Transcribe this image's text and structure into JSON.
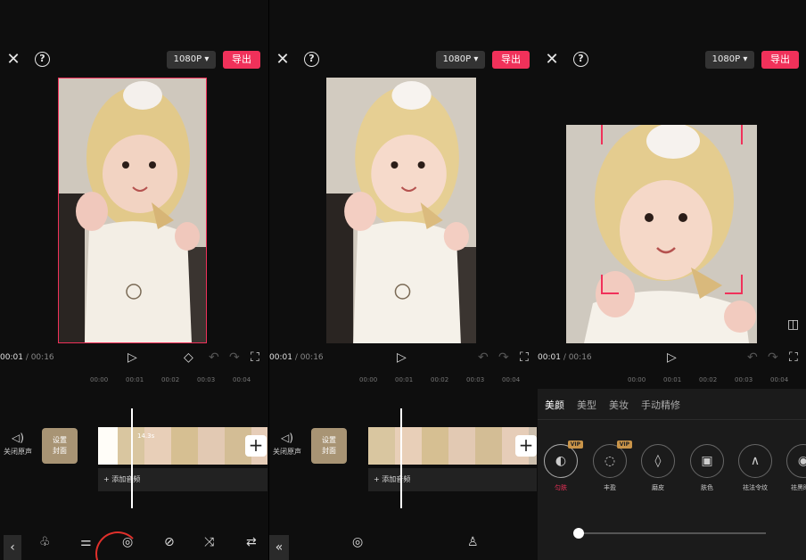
{
  "colors": {
    "accent": "#f0315a",
    "bg": "#0e0e0e"
  },
  "top": {
    "resolution": "1080P ▾",
    "export_label": "导出",
    "close_glyph": "✕",
    "help_glyph": "?"
  },
  "player": {
    "p1": {
      "time_current": "00:01",
      "time_total": "/ 00:16"
    },
    "p2": {
      "time_current": "00:01",
      "time_total": "/ 00:16"
    },
    "p3": {
      "time_current": "00:01",
      "time_total": "/ 00:16"
    }
  },
  "ruler": [
    "00:00",
    "00:01",
    "00:02",
    "00:03",
    "00:04"
  ],
  "timeline": {
    "mute_label": "关闭原声",
    "cover_label_line1": "设置",
    "cover_label_line2": "封面",
    "clip_duration": "14.3s",
    "add_audio_label": "+ 添加音频",
    "plus_glyph": "+"
  },
  "beauty": {
    "tabs": [
      "美颜",
      "美型",
      "美妆",
      "手动精修"
    ],
    "items": [
      {
        "label": "匀肤",
        "icon": "◐",
        "vip": "VIP"
      },
      {
        "label": "丰盈",
        "icon": "◌",
        "vip": "VIP"
      },
      {
        "label": "磨皮",
        "icon": "◊"
      },
      {
        "label": "肤色",
        "icon": "▣"
      },
      {
        "label": "祛法令纹",
        "icon": "∧"
      },
      {
        "label": "祛黑眼圈",
        "icon": "◉"
      }
    ],
    "slider_value": 0
  }
}
